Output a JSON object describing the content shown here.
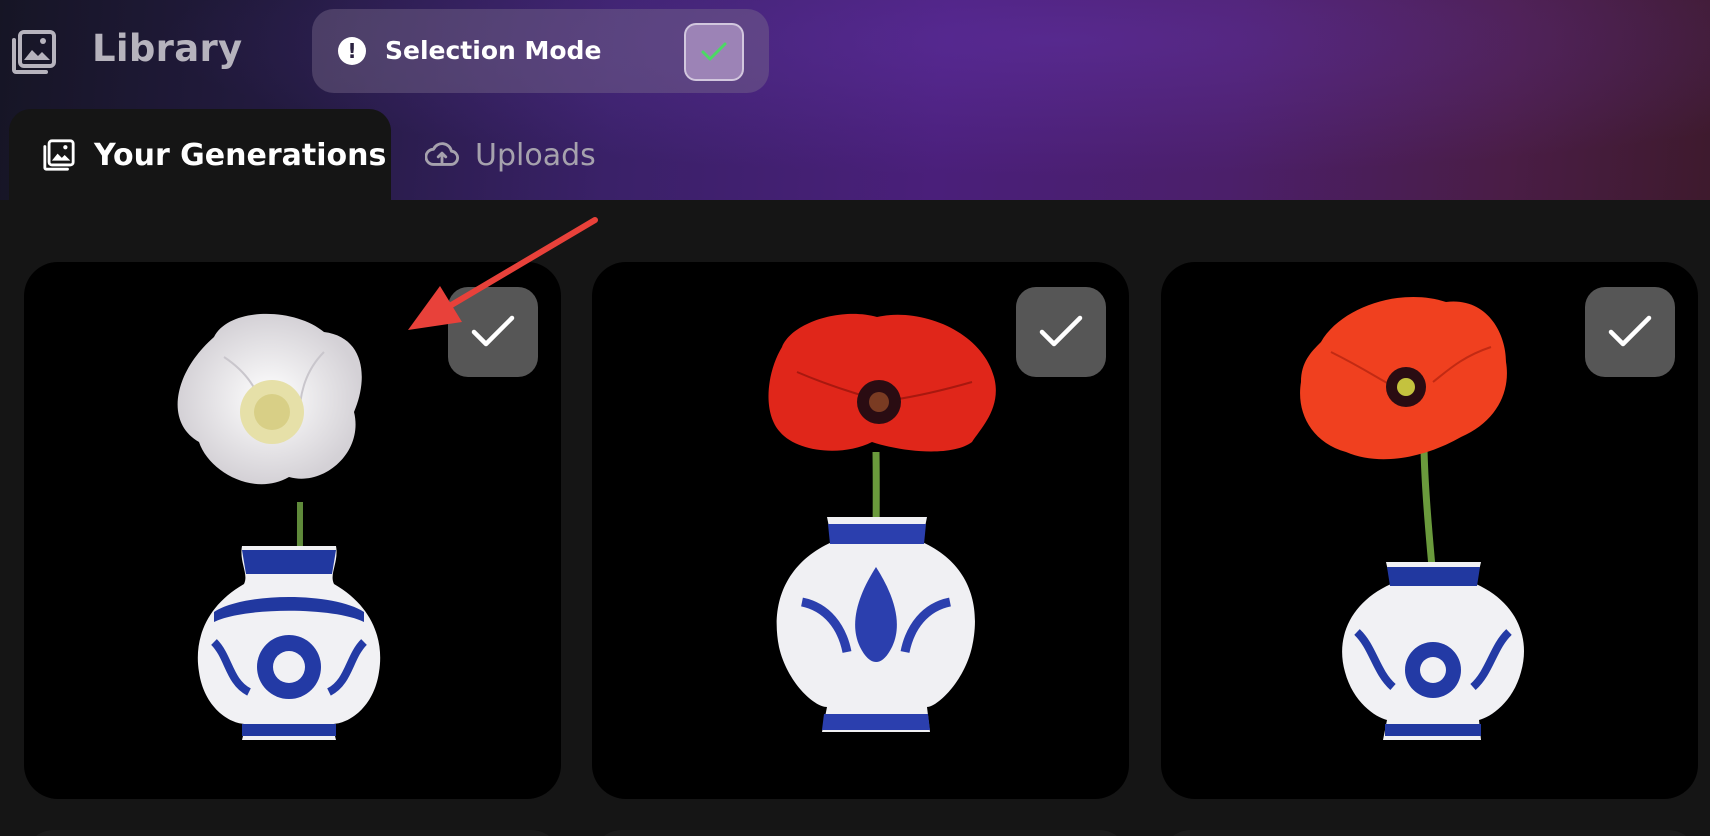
{
  "header": {
    "title": "Library",
    "icon": "gallery-icon",
    "selection_mode": {
      "label": "Selection Mode",
      "icon": "alert-icon",
      "enabled": true,
      "check_color": "#4cd964"
    }
  },
  "tabs": [
    {
      "label": "Your Generations",
      "icon": "gallery-icon",
      "active": true
    },
    {
      "label": "Uploads",
      "icon": "cloud-upload-icon",
      "active": false
    }
  ],
  "gallery": {
    "images": [
      {
        "subject": "white-poppy",
        "flower_color": "#efeef0",
        "selected": true
      },
      {
        "subject": "red-poppy",
        "flower_color": "#e0261a",
        "selected": true
      },
      {
        "subject": "orange-red-poppy",
        "flower_color": "#f0401f",
        "selected": true
      }
    ]
  },
  "annotation": {
    "type": "arrow",
    "color": "#e8413a"
  }
}
